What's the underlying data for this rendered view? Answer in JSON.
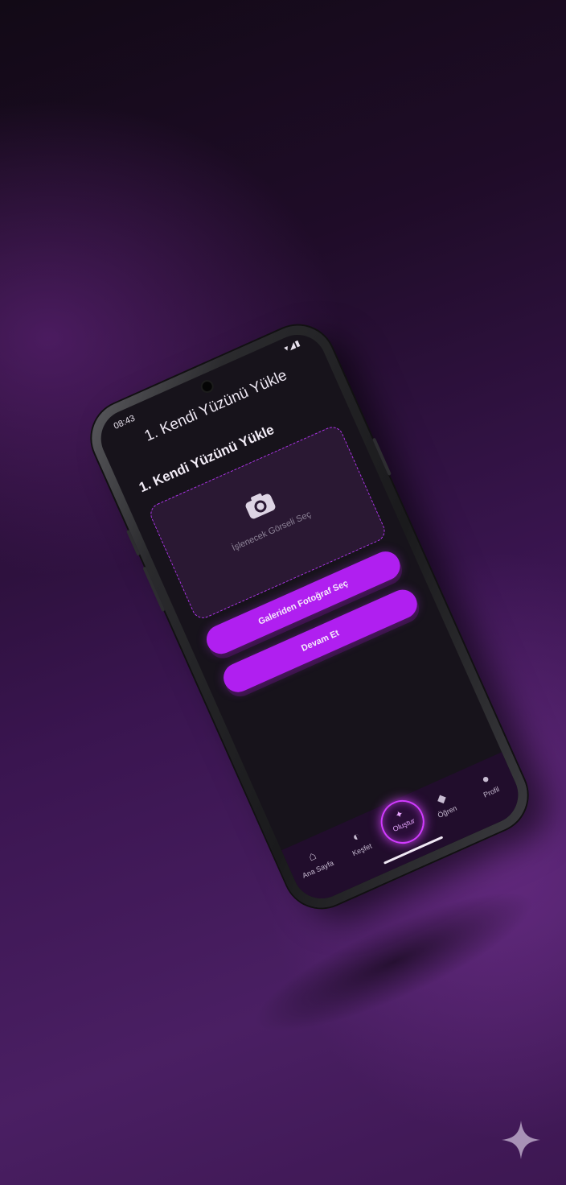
{
  "status_bar": {
    "time": "08:43",
    "icons": "▾◢▮"
  },
  "app_bar": {
    "title": "1. Kendi Yüzünü Yükle"
  },
  "main": {
    "section_title": "1. Kendi Yüzünü Yükle",
    "upload": {
      "icon": "camera-icon",
      "label": "İşlenecek Görseli Seç"
    },
    "gallery_button_label": "Galeriden Fotoğraf Seç",
    "continue_button_label": "Devam Et"
  },
  "bottom_nav": {
    "items": [
      {
        "label": "Ana Sayfa",
        "icon": "home-icon"
      },
      {
        "label": "Keşfet",
        "icon": "compass-icon"
      },
      {
        "label": "Oluştur",
        "icon": "create-icon"
      },
      {
        "label": "Öğren",
        "icon": "graduation-cap-icon"
      },
      {
        "label": "Profil",
        "icon": "person-icon"
      }
    ]
  },
  "colors": {
    "accent": "#b01ff0",
    "screen_background": "#17131b",
    "upload_box_background": "#2a1833",
    "nav_background": "#210d2c"
  }
}
